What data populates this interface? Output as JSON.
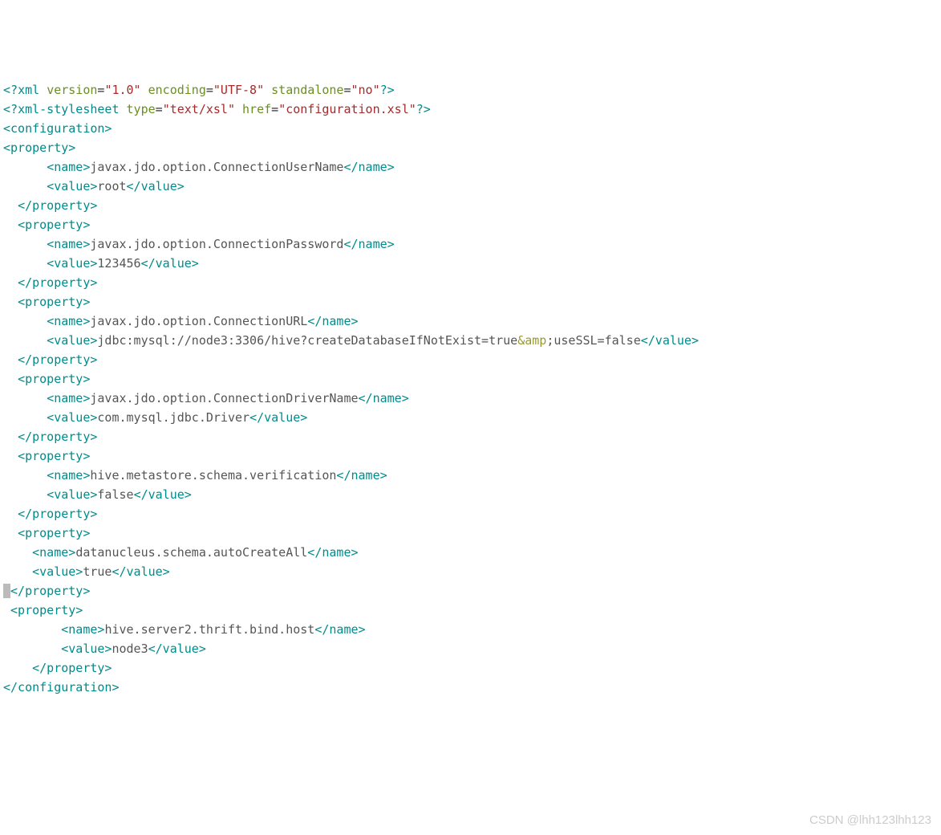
{
  "decl": {
    "pi_open": "<?",
    "pi_name": "xml",
    "ver_attr": "version",
    "ver_val": "\"1.0\"",
    "enc_attr": "encoding",
    "enc_val": "\"UTF-8\"",
    "stand_attr": "standalone",
    "stand_val": "\"no\"",
    "pi_close": "?>"
  },
  "stylesheet": {
    "pi_open": "<?",
    "pi_name": "xml-stylesheet",
    "type_attr": "type",
    "type_val": "\"text/xsl\"",
    "href_attr": "href",
    "href_val": "\"configuration.xsl\"",
    "pi_close": "?>"
  },
  "tags": {
    "configuration_open": "<configuration>",
    "configuration_close": "</configuration>",
    "property_open": "<property>",
    "property_close": "</property>",
    "name_open": "<name>",
    "name_close": "</name>",
    "value_open": "<value>",
    "value_close": "</value>"
  },
  "properties": [
    {
      "name": "javax.jdo.option.ConnectionUserName",
      "value": "root"
    },
    {
      "name": "javax.jdo.option.ConnectionPassword",
      "value": "123456"
    },
    {
      "name": "javax.jdo.option.ConnectionURL",
      "value_pre": "jdbc:mysql://node3:3306/hive?createDatabaseIfNotExist=true",
      "amp": "&amp",
      "semi": ";",
      "value_post": "useSSL=false"
    },
    {
      "name": "javax.jdo.option.ConnectionDriverName",
      "value": "com.mysql.jdbc.Driver"
    },
    {
      "name": "hive.metastore.schema.verification",
      "value": "false"
    },
    {
      "name": "datanucleus.schema.autoCreateAll",
      "value": "true"
    },
    {
      "name": "hive.server2.thrift.bind.host",
      "value": "node3"
    }
  ],
  "watermark": "CSDN @lhh123lhh123"
}
